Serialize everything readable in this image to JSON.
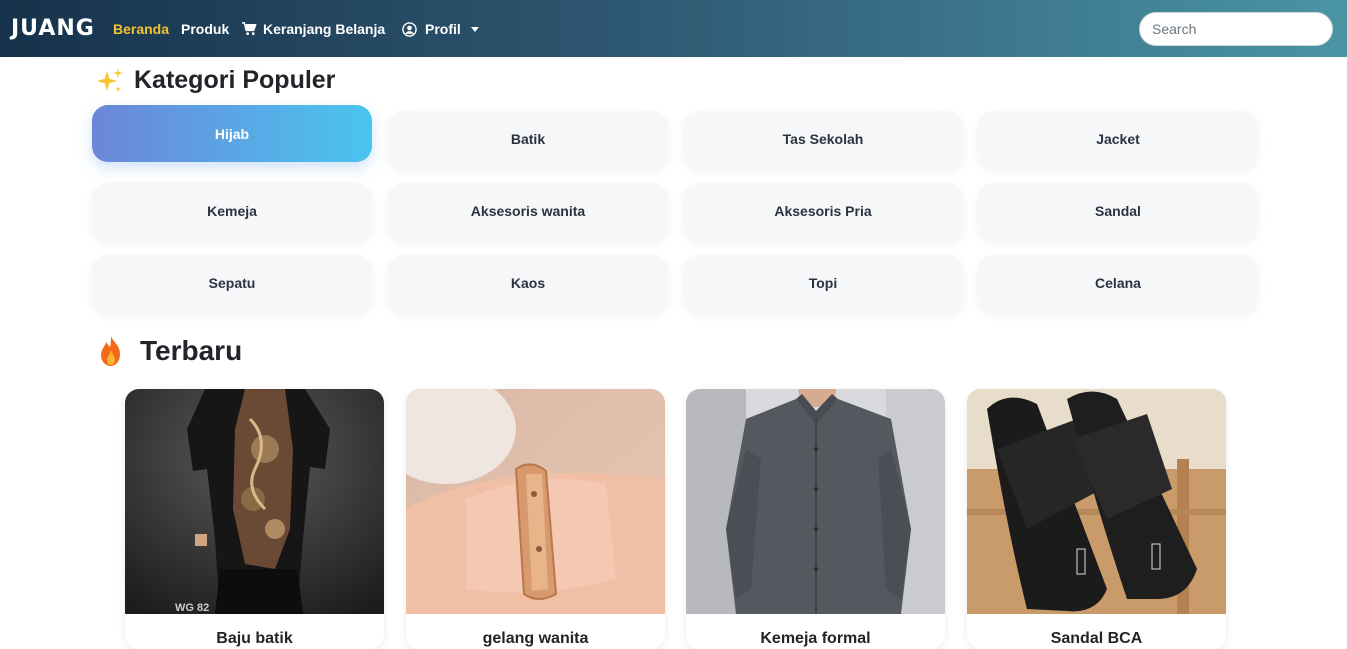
{
  "navbar": {
    "brand": "JUANG",
    "links": [
      {
        "label": "Beranda",
        "active": true
      },
      {
        "label": "Produk",
        "active": false
      },
      {
        "label": "Keranjang Belanja",
        "icon": "cart-icon"
      },
      {
        "label": "Profil",
        "icon": "user-circle-icon",
        "dropdown": true
      }
    ],
    "search_placeholder": "Search",
    "active_color": "#f2c230"
  },
  "kategori": {
    "title": "Kategori Populer",
    "icon": "sparkle-icon",
    "items": [
      "Hijab",
      "Batik",
      "Tas Sekolah",
      "Jacket",
      "Kemeja",
      "Aksesoris wanita",
      "Aksesoris Pria",
      "Sandal",
      "Sepatu",
      "Kaos",
      "Topi",
      "Celana"
    ],
    "active": "Hijab"
  },
  "terbaru": {
    "title": "Terbaru",
    "icon": "fire-icon",
    "products": [
      {
        "name": "Baju batik",
        "image": "batik-shirt-photo",
        "image_caption": "WG 82"
      },
      {
        "name": "gelang wanita",
        "image": "bracelet-photo"
      },
      {
        "name": "Kemeja formal",
        "image": "formal-shirt-photo"
      },
      {
        "name": "Sandal BCA",
        "image": "slide-sandals-photo"
      }
    ]
  }
}
